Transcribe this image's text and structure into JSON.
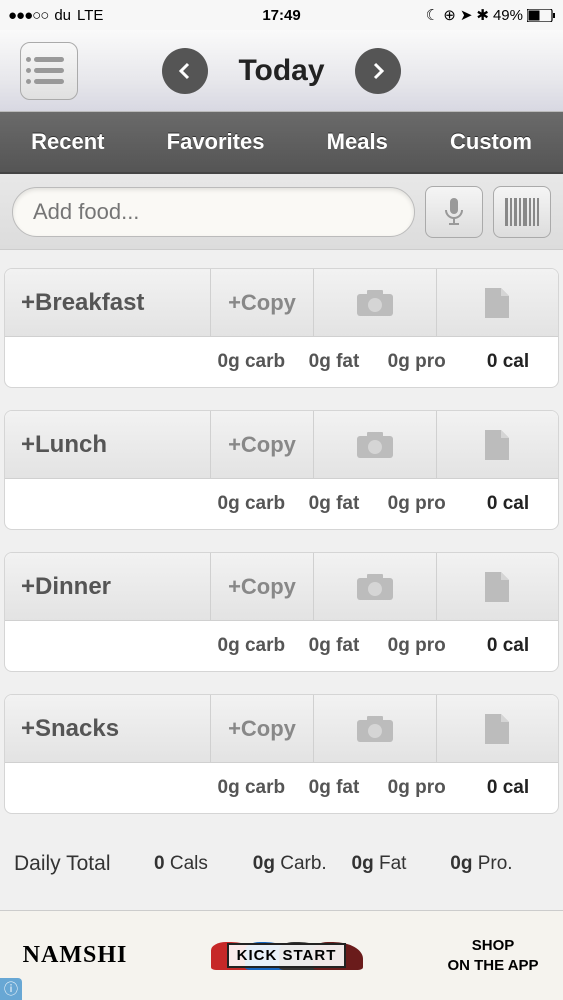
{
  "status": {
    "signal_dots": "●●●○○",
    "carrier": "du",
    "network": "LTE",
    "time": "17:49",
    "battery_pct": "49%"
  },
  "header": {
    "title": "Today"
  },
  "tabs": [
    "Recent",
    "Favorites",
    "Meals",
    "Custom"
  ],
  "search": {
    "placeholder": "Add food..."
  },
  "copy_label": "+Copy",
  "meals": [
    {
      "name": "+Breakfast",
      "carb": "0g carb",
      "fat": "0g fat",
      "pro": "0g pro",
      "cal": "0 cal"
    },
    {
      "name": "+Lunch",
      "carb": "0g carb",
      "fat": "0g fat",
      "pro": "0g pro",
      "cal": "0 cal"
    },
    {
      "name": "+Dinner",
      "carb": "0g carb",
      "fat": "0g fat",
      "pro": "0g pro",
      "cal": "0 cal"
    },
    {
      "name": "+Snacks",
      "carb": "0g carb",
      "fat": "0g fat",
      "pro": "0g pro",
      "cal": "0 cal"
    }
  ],
  "daily": {
    "label": "Daily Total",
    "cals_val": "0",
    "cals_unit": "Cals",
    "carb_val": "0g",
    "carb_unit": "Carb.",
    "fat_val": "0g",
    "fat_unit": "Fat",
    "pro_val": "0g",
    "pro_unit": "Pro."
  },
  "ad": {
    "brand": "NAMSHI",
    "center_text": "KICK START",
    "cta_line1": "SHOP",
    "cta_line2": "ON THE APP"
  }
}
